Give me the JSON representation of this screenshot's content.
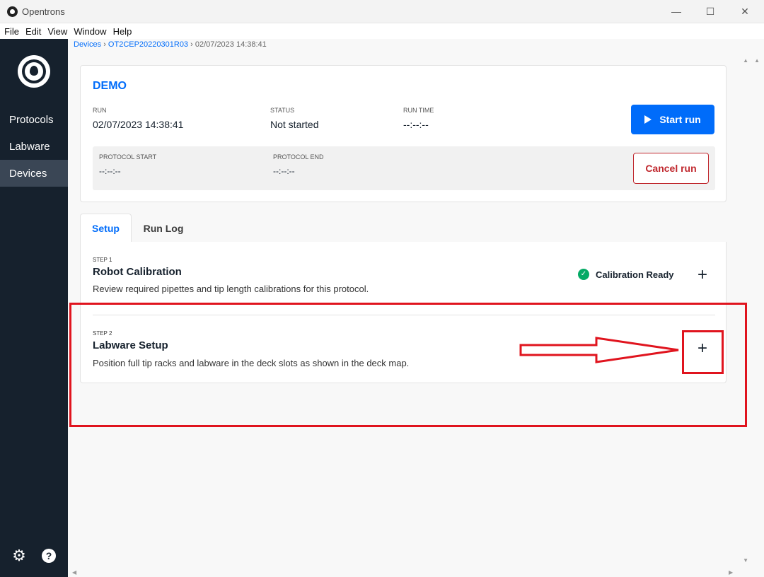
{
  "window": {
    "title": "Opentrons",
    "minimize_glyph": "—",
    "maximize_glyph": "☐",
    "close_glyph": "✕"
  },
  "menubar": [
    "File",
    "Edit",
    "View",
    "Window",
    "Help"
  ],
  "sidebar": {
    "items": [
      {
        "label": "Protocols",
        "active": false
      },
      {
        "label": "Labware",
        "active": false
      },
      {
        "label": "Devices",
        "active": true
      }
    ],
    "footer_icons": [
      "gear-icon",
      "help-icon"
    ]
  },
  "breadcrumb": {
    "devices": "Devices",
    "robot": "OT2CEP20220301R03",
    "run": "02/07/2023 14:38:41",
    "sep": "›"
  },
  "run": {
    "title": "DEMO",
    "run_label": "RUN",
    "run_value": "02/07/2023 14:38:41",
    "status_label": "STATUS",
    "status_value": "Not started",
    "runtime_label": "RUN TIME",
    "runtime_value": "--:--:--",
    "protocol_start_label": "PROTOCOL START",
    "protocol_start_value": "--:--:--",
    "protocol_end_label": "PROTOCOL END",
    "protocol_end_value": "--:--:--",
    "start_button": "Start run",
    "cancel_button": "Cancel run"
  },
  "tabs": [
    {
      "label": "Setup",
      "active": true
    },
    {
      "label": "Run Log",
      "active": false
    }
  ],
  "steps": [
    {
      "step": "STEP 1",
      "title": "Robot Calibration",
      "description": "Review required pipettes and tip length calibrations for this protocol.",
      "status": "Calibration Ready",
      "expand": "+"
    },
    {
      "step": "STEP 2",
      "title": "Labware Setup",
      "description": "Position full tip racks and labware in the deck slots as shown in the deck map.",
      "expand": "+"
    }
  ],
  "colors": {
    "sidebar": "#16212d",
    "accent_blue": "#006cfa",
    "danger": "#c0282e",
    "success": "#04aa65",
    "annotation_red": "#e0141e"
  }
}
